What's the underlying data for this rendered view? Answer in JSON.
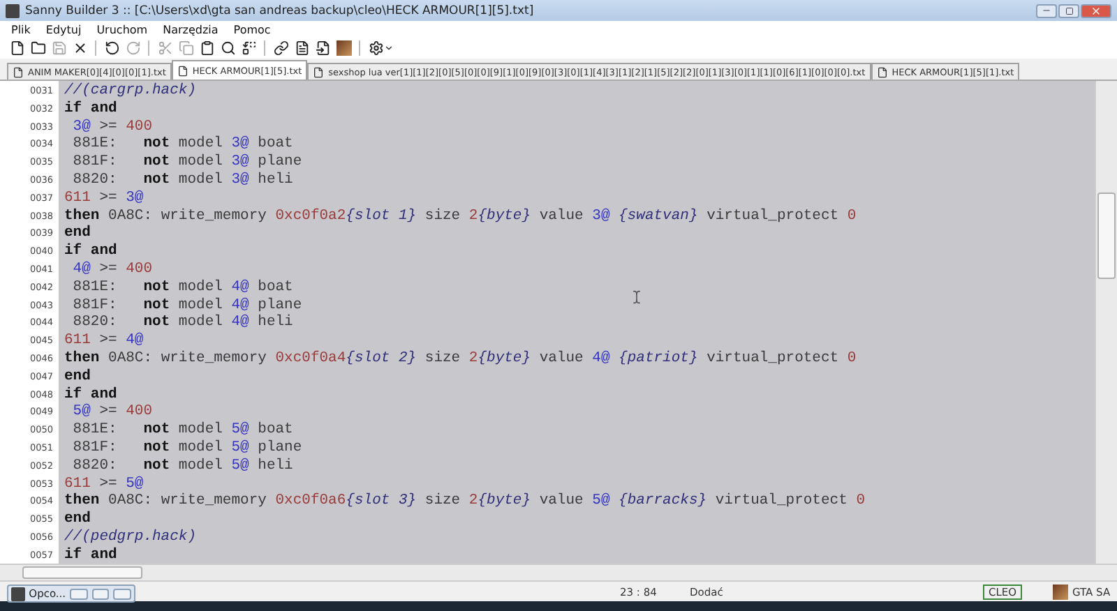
{
  "window": {
    "title": "Sanny Builder 3 :: [C:\\Users\\xd\\gta san andreas backup\\cleo\\HECK ARMOUR[1][5].txt]"
  },
  "menu": [
    "Plik",
    "Edytuj",
    "Uruchom",
    "Narzędzia",
    "Pomoc"
  ],
  "toolbar": [
    {
      "kind": "new",
      "disabled": false
    },
    {
      "kind": "open",
      "disabled": false
    },
    {
      "kind": "save",
      "disabled": true
    },
    {
      "kind": "close",
      "disabled": false
    },
    {
      "kind": "sep"
    },
    {
      "kind": "undo",
      "disabled": false
    },
    {
      "kind": "redo",
      "disabled": true
    },
    {
      "kind": "sep"
    },
    {
      "kind": "cut",
      "disabled": true
    },
    {
      "kind": "copy",
      "disabled": true
    },
    {
      "kind": "paste",
      "disabled": false
    },
    {
      "kind": "find",
      "disabled": false
    },
    {
      "kind": "replace",
      "disabled": false
    },
    {
      "kind": "sep"
    },
    {
      "kind": "link",
      "disabled": false
    },
    {
      "kind": "doc",
      "disabled": false
    },
    {
      "kind": "compile",
      "disabled": false
    },
    {
      "kind": "game",
      "disabled": false
    },
    {
      "kind": "sep"
    },
    {
      "kind": "settings",
      "disabled": false
    }
  ],
  "tabs": [
    {
      "label": "ANIM MAKER[0][4][0][0][1].txt",
      "selected": false
    },
    {
      "label": "HECK ARMOUR[1][5].txt",
      "selected": true
    },
    {
      "label": "sexshop lua ver[1][1][2][0][5][0][0][9][1][0][9][0][3][0][1][4][3][1][2][1][5][2][2][0][1][3][0][1][1][0][6][1][0][0][0].txt",
      "selected": false
    },
    {
      "label": "HECK ARMOUR[1][5][1].txt",
      "selected": false
    }
  ],
  "editor": {
    "lines": [
      {
        "number": "0031",
        "tokens": [
          {
            "kind": "comment",
            "text": "//(cargrp.hack)"
          }
        ]
      },
      {
        "number": "0032",
        "tokens": [
          {
            "kind": "kw",
            "text": "if and"
          }
        ]
      },
      {
        "number": "0033",
        "tokens": [
          {
            "kind": "var",
            "text": " 3@"
          },
          {
            "kind": "text",
            "text": " >= "
          },
          {
            "kind": "num",
            "text": "400"
          }
        ]
      },
      {
        "number": "0034",
        "tokens": [
          {
            "kind": "text",
            "text": " 881E:   "
          },
          {
            "kind": "kw",
            "text": "not"
          },
          {
            "kind": "text",
            "text": " model "
          },
          {
            "kind": "var",
            "text": "3@"
          },
          {
            "kind": "text",
            "text": " boat"
          }
        ]
      },
      {
        "number": "0035",
        "tokens": [
          {
            "kind": "text",
            "text": " 881F:   "
          },
          {
            "kind": "kw",
            "text": "not"
          },
          {
            "kind": "text",
            "text": " model "
          },
          {
            "kind": "var",
            "text": "3@"
          },
          {
            "kind": "text",
            "text": " plane"
          }
        ]
      },
      {
        "number": "0036",
        "tokens": [
          {
            "kind": "text",
            "text": " 8820:   "
          },
          {
            "kind": "kw",
            "text": "not"
          },
          {
            "kind": "text",
            "text": " model "
          },
          {
            "kind": "var",
            "text": "3@"
          },
          {
            "kind": "text",
            "text": " heli"
          }
        ]
      },
      {
        "number": "0037",
        "tokens": [
          {
            "kind": "num",
            "text": "611"
          },
          {
            "kind": "text",
            "text": " >= "
          },
          {
            "kind": "var",
            "text": "3@"
          }
        ]
      },
      {
        "number": "0038",
        "tokens": [
          {
            "kind": "kw",
            "text": "then"
          },
          {
            "kind": "text",
            "text": " 0A8C: write_memory "
          },
          {
            "kind": "num",
            "text": "0xc0f0a2"
          },
          {
            "kind": "note",
            "text": "{slot 1}"
          },
          {
            "kind": "text",
            "text": " size "
          },
          {
            "kind": "num",
            "text": "2"
          },
          {
            "kind": "note",
            "text": "{byte}"
          },
          {
            "kind": "text",
            "text": " value "
          },
          {
            "kind": "var",
            "text": "3@"
          },
          {
            "kind": "note",
            "text": " {swatvan}"
          },
          {
            "kind": "text",
            "text": " virtual_protect "
          },
          {
            "kind": "num",
            "text": "0"
          }
        ]
      },
      {
        "number": "0039",
        "tokens": [
          {
            "kind": "kw",
            "text": "end"
          }
        ]
      },
      {
        "number": "0040",
        "tokens": [
          {
            "kind": "kw",
            "text": "if and"
          }
        ]
      },
      {
        "number": "0041",
        "tokens": [
          {
            "kind": "var",
            "text": " 4@"
          },
          {
            "kind": "text",
            "text": " >= "
          },
          {
            "kind": "num",
            "text": "400"
          }
        ]
      },
      {
        "number": "0042",
        "tokens": [
          {
            "kind": "text",
            "text": " 881E:   "
          },
          {
            "kind": "kw",
            "text": "not"
          },
          {
            "kind": "text",
            "text": " model "
          },
          {
            "kind": "var",
            "text": "4@"
          },
          {
            "kind": "text",
            "text": " boat"
          }
        ]
      },
      {
        "number": "0043",
        "tokens": [
          {
            "kind": "text",
            "text": " 881F:   "
          },
          {
            "kind": "kw",
            "text": "not"
          },
          {
            "kind": "text",
            "text": " model "
          },
          {
            "kind": "var",
            "text": "4@"
          },
          {
            "kind": "text",
            "text": " plane"
          }
        ]
      },
      {
        "number": "0044",
        "tokens": [
          {
            "kind": "text",
            "text": " 8820:   "
          },
          {
            "kind": "kw",
            "text": "not"
          },
          {
            "kind": "text",
            "text": " model "
          },
          {
            "kind": "var",
            "text": "4@"
          },
          {
            "kind": "text",
            "text": " heli"
          }
        ]
      },
      {
        "number": "0045",
        "tokens": [
          {
            "kind": "num",
            "text": "611"
          },
          {
            "kind": "text",
            "text": " >= "
          },
          {
            "kind": "var",
            "text": "4@"
          }
        ]
      },
      {
        "number": "0046",
        "tokens": [
          {
            "kind": "kw",
            "text": "then"
          },
          {
            "kind": "text",
            "text": " 0A8C: write_memory "
          },
          {
            "kind": "num",
            "text": "0xc0f0a4"
          },
          {
            "kind": "note",
            "text": "{slot 2}"
          },
          {
            "kind": "text",
            "text": " size "
          },
          {
            "kind": "num",
            "text": "2"
          },
          {
            "kind": "note",
            "text": "{byte}"
          },
          {
            "kind": "text",
            "text": " value "
          },
          {
            "kind": "var",
            "text": "4@"
          },
          {
            "kind": "note",
            "text": " {patriot}"
          },
          {
            "kind": "text",
            "text": " virtual_protect "
          },
          {
            "kind": "num",
            "text": "0"
          }
        ]
      },
      {
        "number": "0047",
        "tokens": [
          {
            "kind": "kw",
            "text": "end"
          }
        ]
      },
      {
        "number": "0048",
        "tokens": [
          {
            "kind": "kw",
            "text": "if and"
          }
        ]
      },
      {
        "number": "0049",
        "tokens": [
          {
            "kind": "var",
            "text": " 5@"
          },
          {
            "kind": "text",
            "text": " >= "
          },
          {
            "kind": "num",
            "text": "400"
          }
        ]
      },
      {
        "number": "0050",
        "tokens": [
          {
            "kind": "text",
            "text": " 881E:   "
          },
          {
            "kind": "kw",
            "text": "not"
          },
          {
            "kind": "text",
            "text": " model "
          },
          {
            "kind": "var",
            "text": "5@"
          },
          {
            "kind": "text",
            "text": " boat"
          }
        ]
      },
      {
        "number": "0051",
        "tokens": [
          {
            "kind": "text",
            "text": " 881F:   "
          },
          {
            "kind": "kw",
            "text": "not"
          },
          {
            "kind": "text",
            "text": " model "
          },
          {
            "kind": "var",
            "text": "5@"
          },
          {
            "kind": "text",
            "text": " plane"
          }
        ]
      },
      {
        "number": "0052",
        "tokens": [
          {
            "kind": "text",
            "text": " 8820:   "
          },
          {
            "kind": "kw",
            "text": "not"
          },
          {
            "kind": "text",
            "text": " model "
          },
          {
            "kind": "var",
            "text": "5@"
          },
          {
            "kind": "text",
            "text": " heli"
          }
        ]
      },
      {
        "number": "0053",
        "tokens": [
          {
            "kind": "num",
            "text": "611"
          },
          {
            "kind": "text",
            "text": " >= "
          },
          {
            "kind": "var",
            "text": "5@"
          }
        ]
      },
      {
        "number": "0054",
        "tokens": [
          {
            "kind": "kw",
            "text": "then"
          },
          {
            "kind": "text",
            "text": " 0A8C: write_memory "
          },
          {
            "kind": "num",
            "text": "0xc0f0a6"
          },
          {
            "kind": "note",
            "text": "{slot 3}"
          },
          {
            "kind": "text",
            "text": " size "
          },
          {
            "kind": "num",
            "text": "2"
          },
          {
            "kind": "note",
            "text": "{byte}"
          },
          {
            "kind": "text",
            "text": " value "
          },
          {
            "kind": "var",
            "text": "5@"
          },
          {
            "kind": "note",
            "text": " {barracks}"
          },
          {
            "kind": "text",
            "text": " virtual_protect "
          },
          {
            "kind": "num",
            "text": "0"
          }
        ]
      },
      {
        "number": "0055",
        "tokens": [
          {
            "kind": "kw",
            "text": "end"
          }
        ]
      },
      {
        "number": "0056",
        "tokens": [
          {
            "kind": "comment",
            "text": "//(pedgrp.hack)"
          }
        ]
      },
      {
        "number": "0057",
        "tokens": [
          {
            "kind": "kw",
            "text": "if and"
          }
        ]
      }
    ]
  },
  "status_bar": {
    "position": "23 : 84",
    "mode": "Dodać",
    "script_type": "CLEO",
    "game": "GTA SA"
  },
  "minimized_window": {
    "title": "Opco..."
  }
}
